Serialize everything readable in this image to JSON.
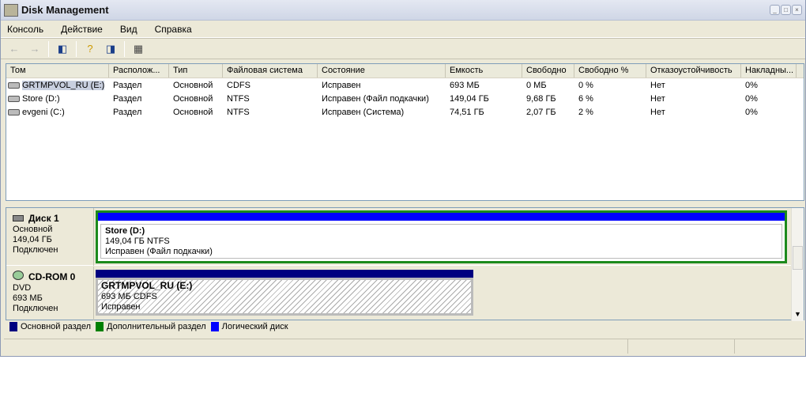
{
  "window": {
    "title": "Disk Management"
  },
  "menu": [
    "Консоль",
    "Действие",
    "Вид",
    "Справка"
  ],
  "columns": [
    "Том",
    "Располож...",
    "Тип",
    "Файловая система",
    "Состояние",
    "Емкость",
    "Свободно",
    "Свободно %",
    "Отказоустойчивость",
    "Накладны..."
  ],
  "rows": [
    [
      "GRTMPVOL_RU (E:)",
      "Раздел",
      "Основной",
      "CDFS",
      "Исправен",
      "693 МБ",
      "0 МБ",
      "0 %",
      "Нет",
      "0%"
    ],
    [
      "Store (D:)",
      "Раздел",
      "Основной",
      "NTFS",
      "Исправен (Файл подкачки)",
      "149,04 ГБ",
      "9,68 ГБ",
      "6 %",
      "Нет",
      "0%"
    ],
    [
      "evgeni (C:)",
      "Раздел",
      "Основной",
      "NTFS",
      "Исправен (Система)",
      "74,51 ГБ",
      "2,07 ГБ",
      "2 %",
      "Нет",
      "0%"
    ]
  ],
  "disks": [
    {
      "name": "Диск 1",
      "type": "Основной",
      "size": "149,04 ГБ",
      "status": "Подключен",
      "volume": {
        "name": "Store  (D:)",
        "info": "149,04 ГБ NTFS",
        "state": "Исправен (Файл подкачки)"
      }
    },
    {
      "name": "CD-ROM 0",
      "type": "DVD",
      "size": "693 МБ",
      "status": "Подключен",
      "volume": {
        "name": "GRTMPVOL_RU  (E:)",
        "info": "693 МБ CDFS",
        "state": "Исправен"
      }
    }
  ],
  "legend": [
    {
      "label": "Основной раздел",
      "color": "#000080"
    },
    {
      "label": "Дополнительный раздел",
      "color": "#008000"
    },
    {
      "label": "Логический диск",
      "color": "#0000ff"
    }
  ]
}
